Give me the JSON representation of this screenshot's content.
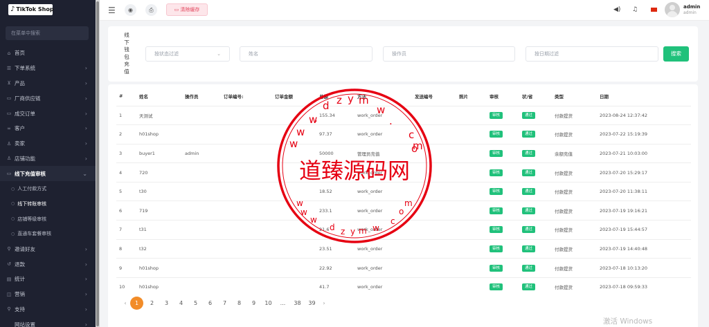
{
  "sidebar": {
    "logo_text": "TikTok Shop",
    "search_placeholder": "在菜单中搜索",
    "items": [
      {
        "label": "首页",
        "icon": "home-icon",
        "glyph": "⌂",
        "chevron": false
      },
      {
        "label": "下单系统",
        "icon": "list-icon",
        "glyph": "☰",
        "chevron": true
      },
      {
        "label": "产品",
        "icon": "cart-icon",
        "glyph": "⊻",
        "chevron": true
      },
      {
        "label": "厂商供应链",
        "icon": "box-icon",
        "glyph": "▭",
        "chevron": true
      },
      {
        "label": "成交订单",
        "icon": "order-icon",
        "glyph": "▭",
        "chevron": true
      },
      {
        "label": "客户",
        "icon": "users-icon",
        "glyph": "∞",
        "chevron": true
      },
      {
        "label": "卖家",
        "icon": "seller-icon",
        "glyph": "♙",
        "chevron": true
      },
      {
        "label": "店铺功能",
        "icon": "store-icon",
        "glyph": "♙",
        "chevron": true
      },
      {
        "label": "线下充值审核",
        "icon": "wallet-icon",
        "glyph": "▭",
        "chevron": true,
        "open": true
      },
      {
        "label": "人工付款方式",
        "sub": true
      },
      {
        "label": "线下转账审核",
        "sub": true,
        "active": true
      },
      {
        "label": "店铺等级审核",
        "sub": true
      },
      {
        "label": "直通车套餐审核",
        "sub": true
      },
      {
        "label": "邀请好友",
        "icon": "share-icon",
        "glyph": "⚲",
        "chevron": true
      },
      {
        "label": "退款",
        "icon": "refund-icon",
        "glyph": "↺",
        "chevron": true
      },
      {
        "label": "统计",
        "icon": "stats-icon",
        "glyph": "▤",
        "chevron": true
      },
      {
        "label": "营销",
        "icon": "marketing-icon",
        "glyph": "◫",
        "chevron": true
      },
      {
        "label": "支持",
        "icon": "support-icon",
        "glyph": "⚲",
        "chevron": true
      },
      {
        "label": "网站设置",
        "icon": "settings-icon",
        "glyph": "",
        "chevron": true
      }
    ]
  },
  "topbar": {
    "clear_cache_label": "清除缓存",
    "user_name": "admin",
    "user_role": "admin"
  },
  "filter": {
    "title_chars": [
      "线",
      "下",
      "钱",
      "包",
      "充",
      "值"
    ],
    "status_placeholder": "按状态过滤",
    "name_placeholder": "姓名",
    "operator_placeholder": "操作员",
    "date_placeholder": "按日期过滤",
    "search_label": "搜索"
  },
  "table": {
    "headers": [
      "#",
      "姓名",
      "操作员",
      "订单编号:",
      "订单金额",
      "总额",
      "方法",
      "发送编号",
      "照片",
      "审核",
      "状/省",
      "类型",
      "日期"
    ],
    "rows": [
      {
        "no": "1",
        "name": "天测试",
        "operator": "",
        "order_no": "",
        "order_amount": "",
        "total": "155.34",
        "method": "work_order",
        "send_no": "",
        "photo": "",
        "audit": "审核",
        "status": "通过",
        "type": "付款提货",
        "date": "2023-08-24 12:37:42"
      },
      {
        "no": "2",
        "name": "h01shop",
        "operator": "",
        "order_no": "",
        "order_amount": "",
        "total": "97.37",
        "method": "work_order",
        "send_no": "",
        "photo": "",
        "audit": "审核",
        "status": "通过",
        "type": "付款提货",
        "date": "2023-07-22 15:19:39"
      },
      {
        "no": "3",
        "name": "buyer1",
        "operator": "admin",
        "order_no": "",
        "order_amount": "",
        "total": "50000",
        "method": "管理员充值",
        "send_no": "",
        "photo": "",
        "audit": "审核",
        "status": "通过",
        "type": "余额充值",
        "date": "2023-07-21 10:03:00"
      },
      {
        "no": "4",
        "name": "720",
        "operator": "",
        "order_no": "",
        "order_amount": "",
        "total": "",
        "method": "work_order",
        "send_no": "",
        "photo": "",
        "audit": "审核",
        "status": "通过",
        "type": "付款提货",
        "date": "2023-07-20 15:29:17"
      },
      {
        "no": "5",
        "name": "t30",
        "operator": "",
        "order_no": "",
        "order_amount": "",
        "total": "18.52",
        "method": "work_order",
        "send_no": "",
        "photo": "",
        "audit": "审核",
        "status": "通过",
        "type": "付款提货",
        "date": "2023-07-20 11:38:11"
      },
      {
        "no": "6",
        "name": "719",
        "operator": "",
        "order_no": "",
        "order_amount": "",
        "total": "233.1",
        "method": "work_order",
        "send_no": "",
        "photo": "",
        "audit": "审核",
        "status": "通过",
        "type": "付款提货",
        "date": "2023-07-19 19:16:21"
      },
      {
        "no": "7",
        "name": "t31",
        "operator": "",
        "order_no": "",
        "order_amount": "",
        "total": "21.6",
        "method": "work_order",
        "send_no": "",
        "photo": "",
        "audit": "审核",
        "status": "通过",
        "type": "付款提货",
        "date": "2023-07-19 15:44:57"
      },
      {
        "no": "8",
        "name": "t32",
        "operator": "",
        "order_no": "",
        "order_amount": "",
        "total": "23.51",
        "method": "work_order",
        "send_no": "",
        "photo": "",
        "audit": "审核",
        "status": "通过",
        "type": "付款提货",
        "date": "2023-07-19 14:40:48"
      },
      {
        "no": "9",
        "name": "h01shop",
        "operator": "",
        "order_no": "",
        "order_amount": "",
        "total": "22.92",
        "method": "work_order",
        "send_no": "",
        "photo": "",
        "audit": "审核",
        "status": "通过",
        "type": "付款提货",
        "date": "2023-07-18 10:13:20"
      },
      {
        "no": "10",
        "name": "h01shop",
        "operator": "",
        "order_no": "",
        "order_amount": "",
        "total": "41.7",
        "method": "work_order",
        "send_no": "",
        "photo": "",
        "audit": "审核",
        "status": "通过",
        "type": "付款提货",
        "date": "2023-07-18 09:59:33"
      }
    ]
  },
  "pagination": {
    "prev": "‹",
    "next": "›",
    "pages": [
      "1",
      "2",
      "3",
      "4",
      "5",
      "6",
      "7",
      "8",
      "9",
      "10",
      "...",
      "38",
      "39"
    ],
    "current": "1"
  },
  "watermark": {
    "text": "道臻源码网",
    "url": "www.dzym.com",
    "color": "#e60012"
  },
  "os_overlay": {
    "text": "激活 Windows"
  },
  "colors": {
    "sidebar_bg": "#1e2130",
    "accent_green": "#20c17b",
    "page_active": "#f28c28",
    "clear_btn": "#e2445c"
  }
}
